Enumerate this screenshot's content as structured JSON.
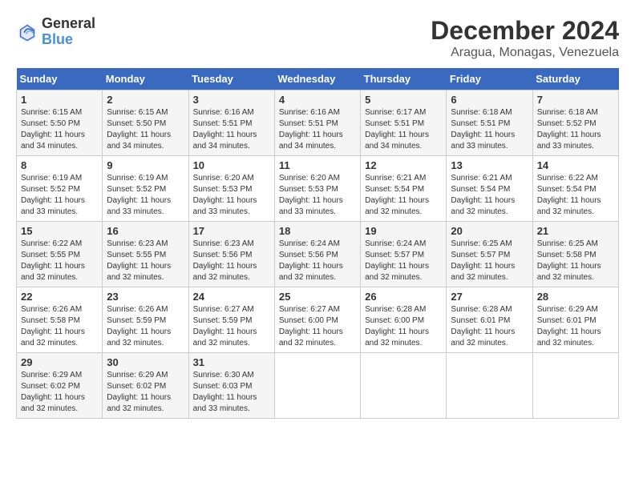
{
  "logo": {
    "general": "General",
    "blue": "Blue"
  },
  "title": "December 2024",
  "subtitle": "Aragua, Monagas, Venezuela",
  "weekdays": [
    "Sunday",
    "Monday",
    "Tuesday",
    "Wednesday",
    "Thursday",
    "Friday",
    "Saturday"
  ],
  "weeks": [
    [
      {
        "day": "1",
        "sunrise": "6:15 AM",
        "sunset": "5:50 PM",
        "daylight": "11 hours and 34 minutes."
      },
      {
        "day": "2",
        "sunrise": "6:15 AM",
        "sunset": "5:50 PM",
        "daylight": "11 hours and 34 minutes."
      },
      {
        "day": "3",
        "sunrise": "6:16 AM",
        "sunset": "5:51 PM",
        "daylight": "11 hours and 34 minutes."
      },
      {
        "day": "4",
        "sunrise": "6:16 AM",
        "sunset": "5:51 PM",
        "daylight": "11 hours and 34 minutes."
      },
      {
        "day": "5",
        "sunrise": "6:17 AM",
        "sunset": "5:51 PM",
        "daylight": "11 hours and 34 minutes."
      },
      {
        "day": "6",
        "sunrise": "6:18 AM",
        "sunset": "5:51 PM",
        "daylight": "11 hours and 33 minutes."
      },
      {
        "day": "7",
        "sunrise": "6:18 AM",
        "sunset": "5:52 PM",
        "daylight": "11 hours and 33 minutes."
      }
    ],
    [
      {
        "day": "8",
        "sunrise": "6:19 AM",
        "sunset": "5:52 PM",
        "daylight": "11 hours and 33 minutes."
      },
      {
        "day": "9",
        "sunrise": "6:19 AM",
        "sunset": "5:52 PM",
        "daylight": "11 hours and 33 minutes."
      },
      {
        "day": "10",
        "sunrise": "6:20 AM",
        "sunset": "5:53 PM",
        "daylight": "11 hours and 33 minutes."
      },
      {
        "day": "11",
        "sunrise": "6:20 AM",
        "sunset": "5:53 PM",
        "daylight": "11 hours and 33 minutes."
      },
      {
        "day": "12",
        "sunrise": "6:21 AM",
        "sunset": "5:54 PM",
        "daylight": "11 hours and 32 minutes."
      },
      {
        "day": "13",
        "sunrise": "6:21 AM",
        "sunset": "5:54 PM",
        "daylight": "11 hours and 32 minutes."
      },
      {
        "day": "14",
        "sunrise": "6:22 AM",
        "sunset": "5:54 PM",
        "daylight": "11 hours and 32 minutes."
      }
    ],
    [
      {
        "day": "15",
        "sunrise": "6:22 AM",
        "sunset": "5:55 PM",
        "daylight": "11 hours and 32 minutes."
      },
      {
        "day": "16",
        "sunrise": "6:23 AM",
        "sunset": "5:55 PM",
        "daylight": "11 hours and 32 minutes."
      },
      {
        "day": "17",
        "sunrise": "6:23 AM",
        "sunset": "5:56 PM",
        "daylight": "11 hours and 32 minutes."
      },
      {
        "day": "18",
        "sunrise": "6:24 AM",
        "sunset": "5:56 PM",
        "daylight": "11 hours and 32 minutes."
      },
      {
        "day": "19",
        "sunrise": "6:24 AM",
        "sunset": "5:57 PM",
        "daylight": "11 hours and 32 minutes."
      },
      {
        "day": "20",
        "sunrise": "6:25 AM",
        "sunset": "5:57 PM",
        "daylight": "11 hours and 32 minutes."
      },
      {
        "day": "21",
        "sunrise": "6:25 AM",
        "sunset": "5:58 PM",
        "daylight": "11 hours and 32 minutes."
      }
    ],
    [
      {
        "day": "22",
        "sunrise": "6:26 AM",
        "sunset": "5:58 PM",
        "daylight": "11 hours and 32 minutes."
      },
      {
        "day": "23",
        "sunrise": "6:26 AM",
        "sunset": "5:59 PM",
        "daylight": "11 hours and 32 minutes."
      },
      {
        "day": "24",
        "sunrise": "6:27 AM",
        "sunset": "5:59 PM",
        "daylight": "11 hours and 32 minutes."
      },
      {
        "day": "25",
        "sunrise": "6:27 AM",
        "sunset": "6:00 PM",
        "daylight": "11 hours and 32 minutes."
      },
      {
        "day": "26",
        "sunrise": "6:28 AM",
        "sunset": "6:00 PM",
        "daylight": "11 hours and 32 minutes."
      },
      {
        "day": "27",
        "sunrise": "6:28 AM",
        "sunset": "6:01 PM",
        "daylight": "11 hours and 32 minutes."
      },
      {
        "day": "28",
        "sunrise": "6:29 AM",
        "sunset": "6:01 PM",
        "daylight": "11 hours and 32 minutes."
      }
    ],
    [
      {
        "day": "29",
        "sunrise": "6:29 AM",
        "sunset": "6:02 PM",
        "daylight": "11 hours and 32 minutes."
      },
      {
        "day": "30",
        "sunrise": "6:29 AM",
        "sunset": "6:02 PM",
        "daylight": "11 hours and 32 minutes."
      },
      {
        "day": "31",
        "sunrise": "6:30 AM",
        "sunset": "6:03 PM",
        "daylight": "11 hours and 33 minutes."
      },
      null,
      null,
      null,
      null
    ]
  ],
  "labels": {
    "sunrise": "Sunrise:",
    "sunset": "Sunset:",
    "daylight": "Daylight:"
  }
}
